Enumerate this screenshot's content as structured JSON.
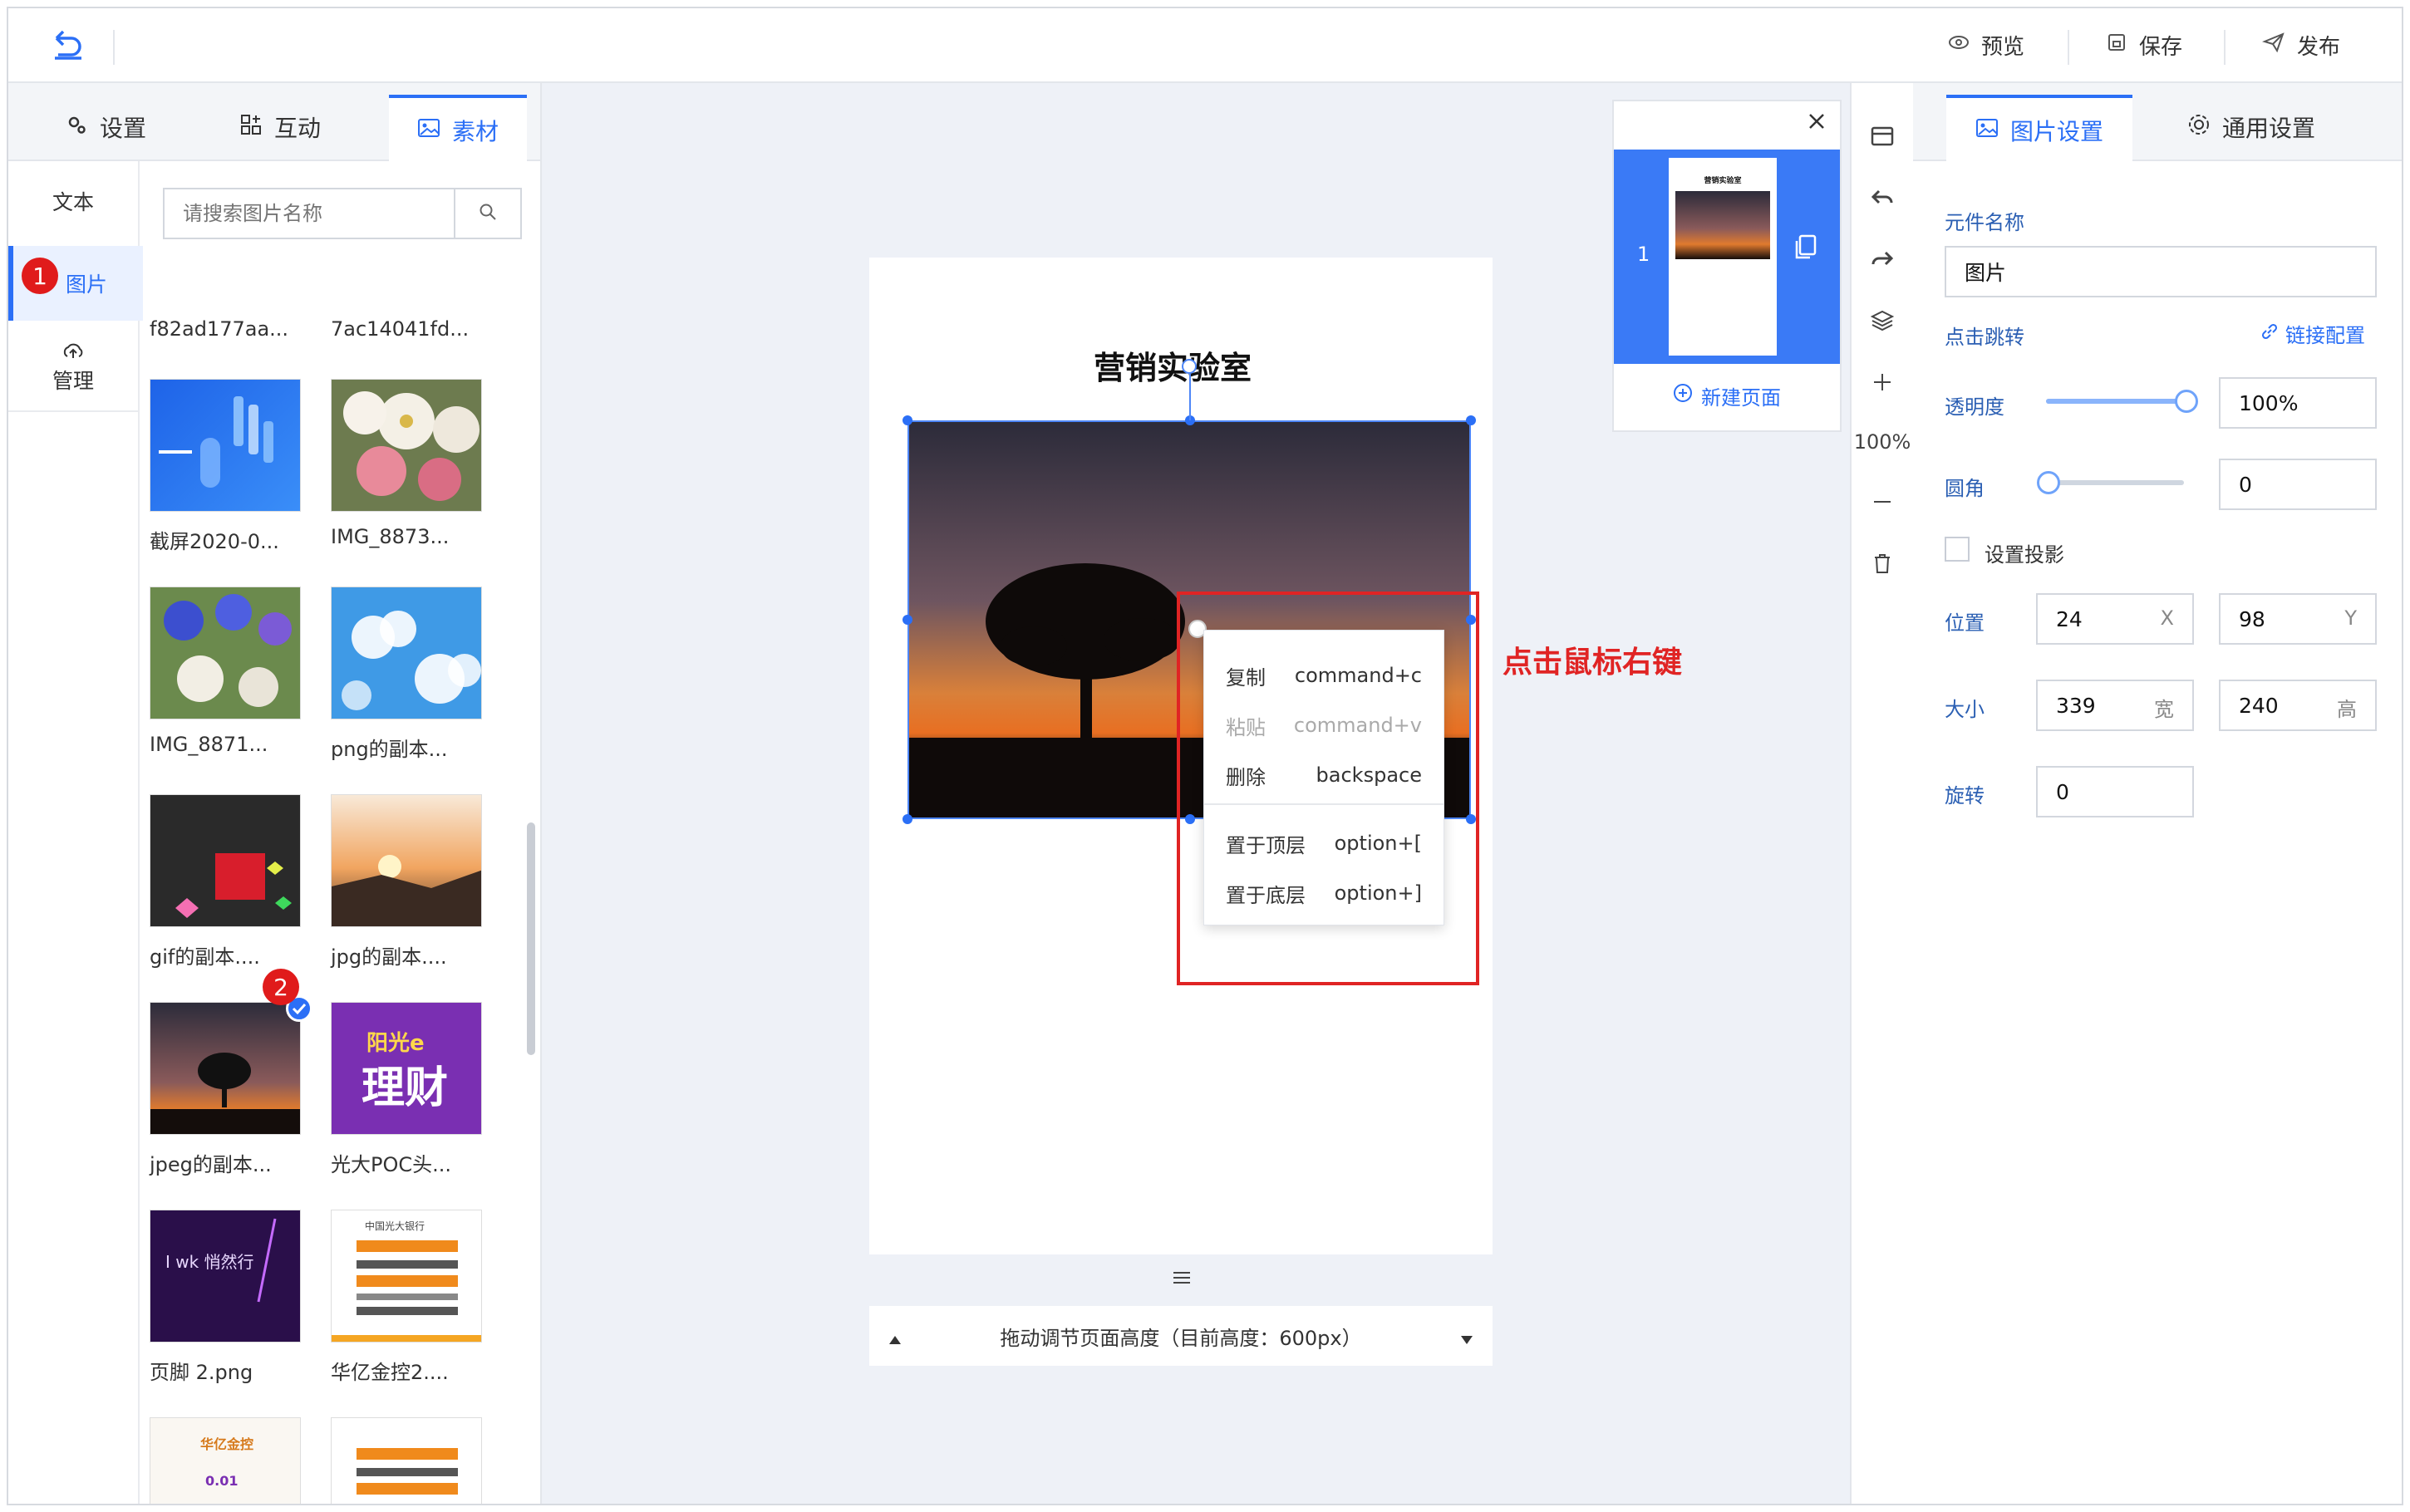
{
  "topbar": {
    "preview": "预览",
    "save": "保存",
    "publish": "发布"
  },
  "left_tabs": {
    "settings": "设置",
    "interact": "互动",
    "material": "素材"
  },
  "left_nav": {
    "text": "文本",
    "image": "图片",
    "manage": "管理"
  },
  "search": {
    "placeholder": "请搜索图片名称"
  },
  "images": [
    {
      "name": "f82ad177aa..."
    },
    {
      "name": "7ac14041fd..."
    },
    {
      "name": "截屏2020-0..."
    },
    {
      "name": "IMG_8873..."
    },
    {
      "name": "IMG_8871..."
    },
    {
      "name": "png的副本..."
    },
    {
      "name": "gif的副本...."
    },
    {
      "name": "jpg的副本...."
    },
    {
      "name": "jpeg的副本..."
    },
    {
      "name": "光大POC头..."
    },
    {
      "name": "页脚 2.png"
    },
    {
      "name": "华亿金控2...."
    }
  ],
  "thumb_text": {
    "poc_top": "阳光e",
    "poc_main": "理财",
    "footer_text": "I wk 悄然行",
    "bank_header": "中国光大银行",
    "huayi": "华亿金控",
    "huayi_value": "0.01"
  },
  "badges": {
    "first": "1",
    "second": "2"
  },
  "canvas": {
    "title": "营销实验室",
    "height_bar": "拖动调节页面高度（目前高度：600px）",
    "annotation": "点击鼠标右键"
  },
  "context_menu": [
    {
      "label": "复制",
      "shortcut": "command+c",
      "disabled": false
    },
    {
      "label": "粘贴",
      "shortcut": "command+v",
      "disabled": true
    },
    {
      "label": "删除",
      "shortcut": "backspace",
      "disabled": false
    },
    {
      "label": "置于顶层",
      "shortcut": "option+[",
      "disabled": false
    },
    {
      "label": "置于底层",
      "shortcut": "option+]",
      "disabled": false
    }
  ],
  "pages_panel": {
    "page_number": "1",
    "mini_title": "营销实验室",
    "new_page": "新建页面"
  },
  "zoom": "100%",
  "right_tabs": {
    "image_settings": "图片设置",
    "general_settings": "通用设置"
  },
  "props": {
    "name_label": "元件名称",
    "name_value": "图片",
    "jump_label": "点击跳转",
    "link_config": "链接配置",
    "opacity_label": "透明度",
    "opacity_value": "100%",
    "opacity_level": 1.0,
    "radius_label": "圆角",
    "radius_value": "0",
    "radius_level": 0,
    "shadow_label": "设置投影",
    "position_label": "位置",
    "pos_x": "24",
    "pos_x_suffix": "X",
    "pos_y": "98",
    "pos_y_suffix": "Y",
    "size_label": "大小",
    "width": "339",
    "width_suffix": "宽",
    "height": "240",
    "height_suffix": "高",
    "rotate_label": "旋转",
    "rotate_value": "0"
  },
  "colors": {
    "accent": "#2b6ff6",
    "annotation_red": "#e02424",
    "label_blue": "#2b5fb3"
  }
}
